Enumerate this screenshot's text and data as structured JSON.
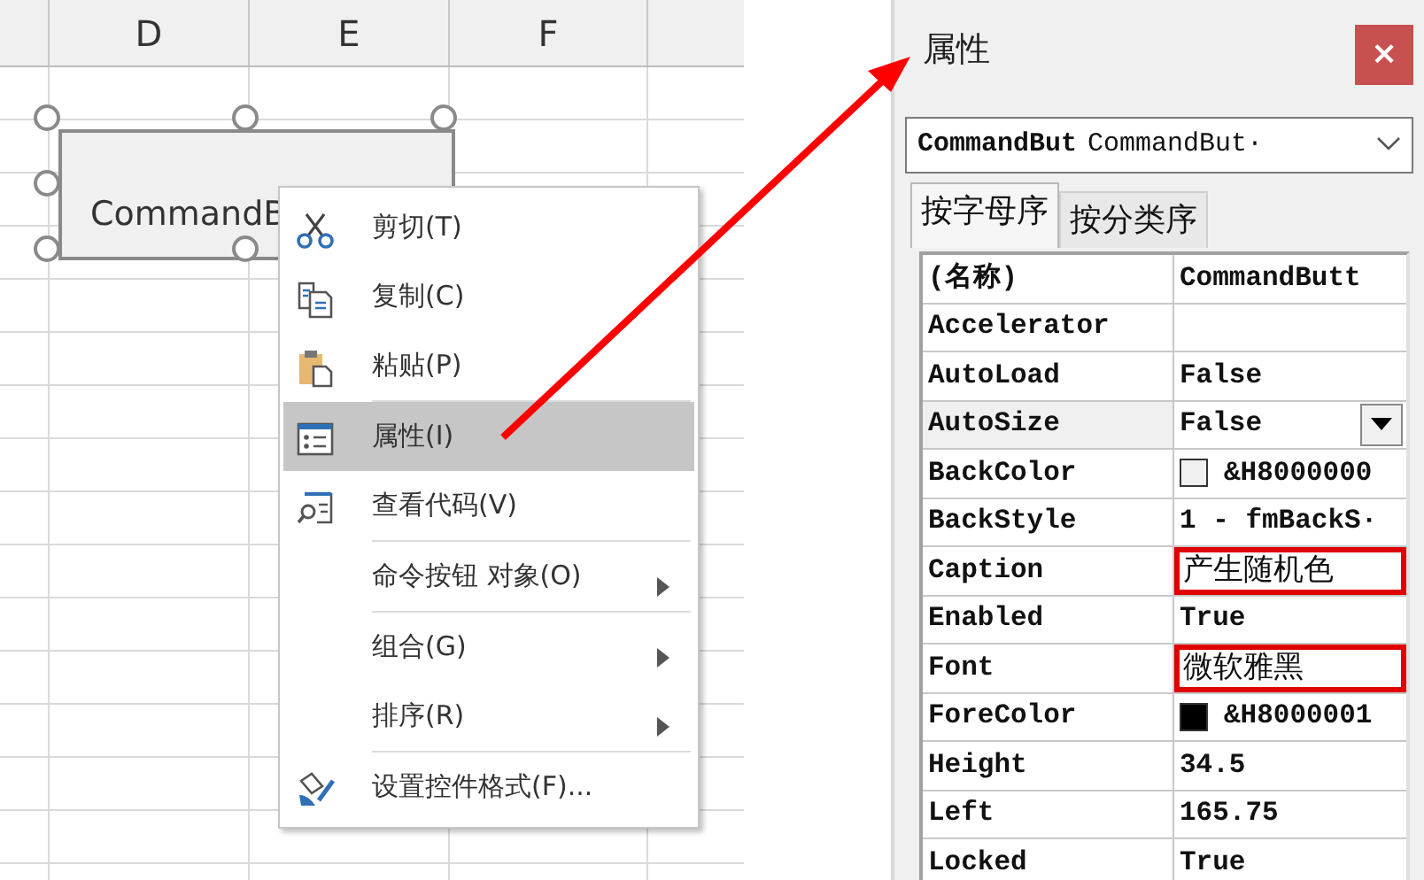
{
  "sheet": {
    "columns": [
      "",
      "D",
      "E",
      "F",
      ""
    ],
    "control": {
      "label": "CommandB",
      "selected": true
    }
  },
  "context_menu": {
    "items": [
      {
        "label": "剪切(T)",
        "selected": false,
        "submenu": false,
        "separator_before": false
      },
      {
        "label": "复制(C)",
        "selected": false,
        "submenu": false,
        "separator_before": false
      },
      {
        "label": "粘贴(P)",
        "selected": false,
        "submenu": false,
        "separator_before": false
      },
      {
        "label": "属性(I)",
        "selected": true,
        "submenu": false,
        "separator_before": true
      },
      {
        "label": "查看代码(V)",
        "selected": false,
        "submenu": false,
        "separator_before": false
      },
      {
        "label": "命令按钮 对象(O)",
        "selected": false,
        "submenu": true,
        "separator_before": true
      },
      {
        "label": "组合(G)",
        "selected": false,
        "submenu": true,
        "separator_before": true
      },
      {
        "label": "排序(R)",
        "selected": false,
        "submenu": true,
        "separator_before": false
      },
      {
        "label": "设置控件格式(F)...",
        "selected": false,
        "submenu": false,
        "separator_before": true
      }
    ]
  },
  "properties_window": {
    "title": "属性",
    "close": "×",
    "object_combo": {
      "name": "CommandBut",
      "type": "CommandBut·"
    },
    "tabs": [
      {
        "label": "按字母序",
        "selected": true
      },
      {
        "label": "按分类序",
        "selected": false
      }
    ],
    "rows": [
      {
        "name": "(名称)",
        "value": "CommandButt",
        "kind": "text",
        "highlighted": false
      },
      {
        "name": "Accelerator",
        "value": "",
        "kind": "text",
        "highlighted": false
      },
      {
        "name": "AutoLoad",
        "value": "False",
        "kind": "text",
        "highlighted": false
      },
      {
        "name": "AutoSize",
        "value": "False",
        "kind": "dropdown",
        "highlighted": false
      },
      {
        "name": "BackColor",
        "value": "&H8000000",
        "kind": "color",
        "color": "#f0f0f0",
        "highlighted": false
      },
      {
        "name": "BackStyle",
        "value": "1 - fmBackS·",
        "kind": "text",
        "highlighted": false
      },
      {
        "name": "Caption",
        "value": "产生随机色",
        "kind": "text",
        "highlighted": true
      },
      {
        "name": "Enabled",
        "value": "True",
        "kind": "text",
        "highlighted": false
      },
      {
        "name": "Font",
        "value": "微软雅黑",
        "kind": "text",
        "highlighted": true
      },
      {
        "name": "ForeColor",
        "value": "&H8000001",
        "kind": "color",
        "color": "#000000",
        "highlighted": false
      },
      {
        "name": "Height",
        "value": "34.5",
        "kind": "text",
        "highlighted": false
      },
      {
        "name": "Left",
        "value": "165.75",
        "kind": "text",
        "highlighted": false
      },
      {
        "name": "Locked",
        "value": "True",
        "kind": "text",
        "highlighted": false
      }
    ]
  }
}
